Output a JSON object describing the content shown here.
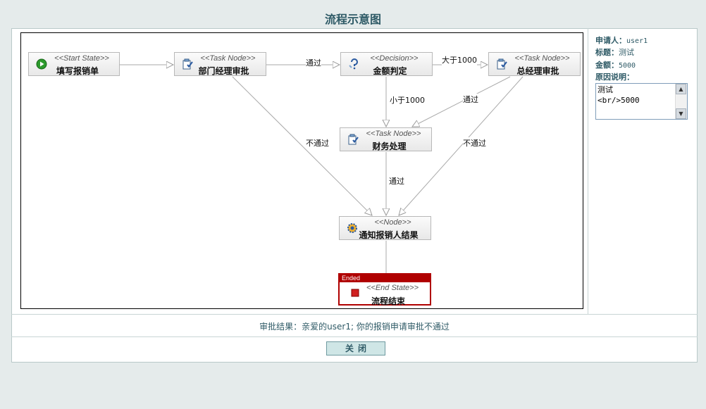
{
  "page": {
    "title": "流程示意图"
  },
  "diagram": {
    "nodes": {
      "start": {
        "stereotype": "<<Start State>>",
        "name": "填写报销单"
      },
      "dept": {
        "stereotype": "<<Task Node>>",
        "name": "部门经理审批"
      },
      "decision": {
        "stereotype": "<<Decision>>",
        "name": "金额判定"
      },
      "gm": {
        "stereotype": "<<Task Node>>",
        "name": "总经理审批"
      },
      "finance": {
        "stereotype": "<<Task Node>>",
        "name": "财务处理"
      },
      "notify": {
        "stereotype": "<<Node>>",
        "name": "通知报销人结果"
      },
      "end": {
        "stereotype": "<<End State>>",
        "name": "流程结束",
        "status": "Ended"
      }
    },
    "labels": {
      "dept_pass": "通过",
      "gt1000": "大于1000",
      "lt1000": "小于1000",
      "gm_pass": "通过",
      "dept_fail": "不通过",
      "gm_fail": "不通过",
      "finance_pass": "通过"
    }
  },
  "info": {
    "applicant_label": "申请人：",
    "applicant": "user1",
    "title_label": "标题：",
    "title": "测试",
    "amount_label": "金额：",
    "amount": "5000",
    "reason_label": "原因说明：",
    "reason": "测试\n<br/>5000"
  },
  "result": {
    "text": "审批结果：亲爱的user1; 你的报销申请审批不通过"
  },
  "actions": {
    "close_label": "关闭"
  },
  "colors": {
    "accent": "#2e5a66",
    "end_state": "#b00000",
    "button_bg": "#cfe6e6"
  }
}
